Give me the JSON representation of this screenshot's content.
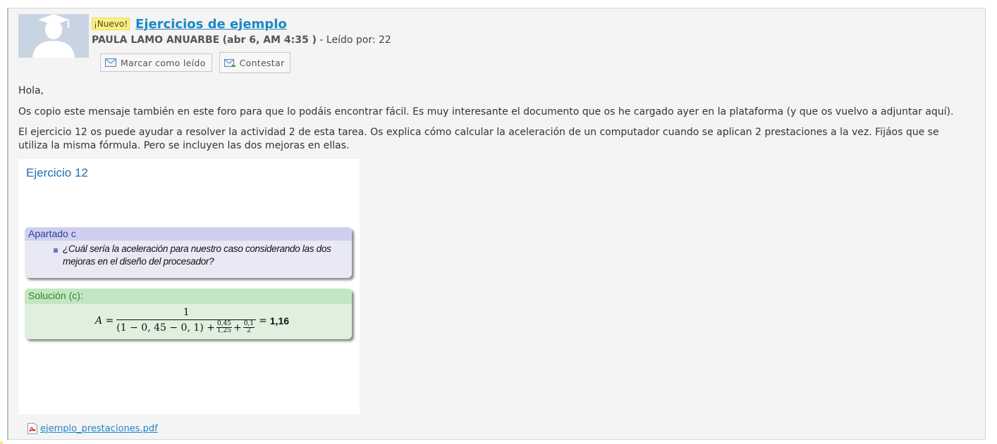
{
  "post": {
    "new_badge": "¡Nuevo!",
    "title": "Ejercicios de ejemplo",
    "author": "PAULA LAMO ANUARBE",
    "date": "(abr 6, AM 4:35 )",
    "read_by": "- Leído por: 22",
    "mark_read_label": "Marcar como leído",
    "reply_label": "Contestar"
  },
  "body": {
    "greeting": "Hola,",
    "paragraph1": "Os copio este mensaje también en este foro para que lo podáis encontrar fácil. Es muy interesante el documento que os he cargado ayer en la plataforma (y que os vuelvo a adjuntar aquí).",
    "paragraph2": "El ejercicio 12 os puede ayudar a resolver la actividad 2 de esta tarea. Os explica cómo calcular la aceleración de un computador cuando se aplican 2 prestaciones a la vez. Fijáos que se utiliza la misma fórmula. Pero se incluyen las dos mejoras en ellas."
  },
  "slide": {
    "title": "Ejercicio 12",
    "question_header": "Apartado c",
    "question": "¿Cuál sería la aceleración para nuestro caso considerando las dos mejoras en el diseño del procesador?",
    "solution_header": "Solución (c):",
    "formula": {
      "lhs": "A =",
      "numerator": "1",
      "den_part1": "(1 − 0, 45 − 0, 1) +",
      "frac1_num": "0,45",
      "frac1_den": "1,25",
      "plus": "+",
      "frac2_num": "0,1",
      "frac2_den": "2",
      "equals": "=",
      "result": "1,16"
    }
  },
  "attachment": {
    "filename": "ejemplo_prestaciones.pdf"
  },
  "colors": {
    "link": "#1b87c6",
    "badge": "#fff07a",
    "question_box": "#e9e9f5",
    "solution_box": "#dff0df"
  }
}
